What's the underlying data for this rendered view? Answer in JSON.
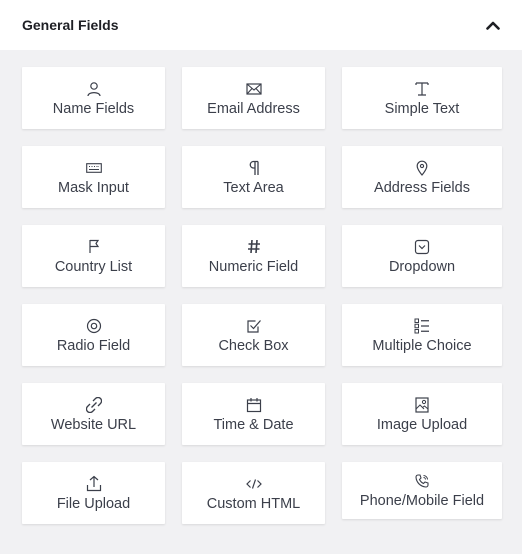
{
  "header": {
    "title": "General Fields"
  },
  "fields": [
    {
      "label": "Name Fields",
      "icon": "user-icon"
    },
    {
      "label": "Email Address",
      "icon": "envelope-icon"
    },
    {
      "label": "Simple Text",
      "icon": "text-cursor-icon"
    },
    {
      "label": "Mask Input",
      "icon": "keyboard-icon"
    },
    {
      "label": "Text Area",
      "icon": "paragraph-icon"
    },
    {
      "label": "Address Fields",
      "icon": "map-pin-icon"
    },
    {
      "label": "Country List",
      "icon": "flag-icon"
    },
    {
      "label": "Numeric Field",
      "icon": "hash-icon"
    },
    {
      "label": "Dropdown",
      "icon": "dropdown-icon"
    },
    {
      "label": "Radio Field",
      "icon": "radio-icon"
    },
    {
      "label": "Check Box",
      "icon": "checkbox-icon"
    },
    {
      "label": "Multiple Choice",
      "icon": "list-icon"
    },
    {
      "label": "Website URL",
      "icon": "link-icon"
    },
    {
      "label": "Time & Date",
      "icon": "calendar-icon"
    },
    {
      "label": "Image Upload",
      "icon": "image-icon"
    },
    {
      "label": "File Upload",
      "icon": "upload-icon"
    },
    {
      "label": "Custom HTML",
      "icon": "code-icon"
    },
    {
      "label": "Phone/Mobile Field",
      "icon": "phone-icon"
    }
  ]
}
